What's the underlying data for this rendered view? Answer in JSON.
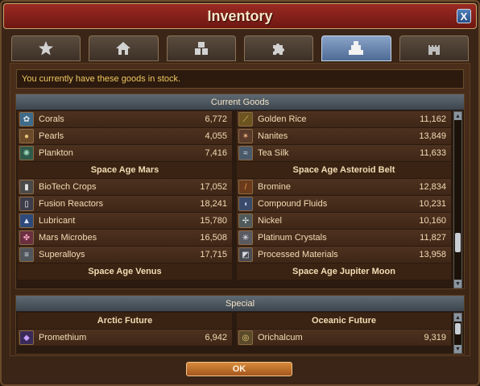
{
  "window": {
    "title": "Inventory",
    "close_label": "X"
  },
  "tabs": [
    {
      "icon": "star-icon"
    },
    {
      "icon": "house-icon"
    },
    {
      "icon": "boxes-icon"
    },
    {
      "icon": "puzzle-icon"
    },
    {
      "icon": "goods-icon",
      "active": true
    },
    {
      "icon": "castle-icon"
    }
  ],
  "info_text": "You currently have these goods in stock.",
  "current_goods": {
    "header": "Current Goods",
    "left": {
      "top_rows": [
        {
          "name": "Corals",
          "qty": "6,772",
          "icon": "coral-icon"
        },
        {
          "name": "Pearls",
          "qty": "4,055",
          "icon": "pearl-icon"
        },
        {
          "name": "Plankton",
          "qty": "7,416",
          "icon": "plankton-icon"
        }
      ],
      "section": "Space Age Mars",
      "rows": [
        {
          "name": "BioTech Crops",
          "qty": "17,052",
          "icon": "biotech-icon"
        },
        {
          "name": "Fusion Reactors",
          "qty": "18,241",
          "icon": "reactor-icon"
        },
        {
          "name": "Lubricant",
          "qty": "15,780",
          "icon": "lubricant-icon"
        },
        {
          "name": "Mars Microbes",
          "qty": "16,508",
          "icon": "microbes-icon"
        },
        {
          "name": "Superalloys",
          "qty": "17,715",
          "icon": "superalloys-icon"
        }
      ],
      "bottom_section": "Space Age Venus"
    },
    "right": {
      "top_rows": [
        {
          "name": "Golden Rice",
          "qty": "11,162",
          "icon": "rice-icon"
        },
        {
          "name": "Nanites",
          "qty": "13,849",
          "icon": "nanites-icon"
        },
        {
          "name": "Tea Silk",
          "qty": "11,633",
          "icon": "teasilk-icon"
        }
      ],
      "section": "Space Age Asteroid Belt",
      "rows": [
        {
          "name": "Bromine",
          "qty": "12,834",
          "icon": "bromine-icon"
        },
        {
          "name": "Compound Fluids",
          "qty": "10,231",
          "icon": "fluids-icon"
        },
        {
          "name": "Nickel",
          "qty": "10,160",
          "icon": "nickel-icon"
        },
        {
          "name": "Platinum Crystals",
          "qty": "11,827",
          "icon": "platinum-icon"
        },
        {
          "name": "Processed Materials",
          "qty": "13,958",
          "icon": "materials-icon"
        }
      ],
      "bottom_section": "Space Age Jupiter Moon"
    }
  },
  "special": {
    "header": "Special",
    "left": {
      "section": "Arctic Future",
      "rows": [
        {
          "name": "Promethium",
          "qty": "6,942",
          "icon": "promethium-icon"
        }
      ]
    },
    "right": {
      "section": "Oceanic Future",
      "rows": [
        {
          "name": "Orichalcum",
          "qty": "9,319",
          "icon": "orichalcum-icon"
        }
      ]
    }
  },
  "ok_label": "OK"
}
